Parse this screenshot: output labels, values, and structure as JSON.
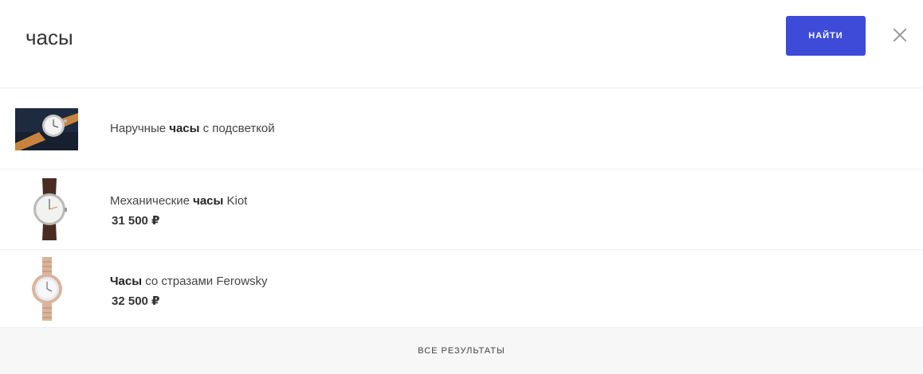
{
  "search": {
    "query": "часы",
    "button_label": "НАЙТИ",
    "accent_color": "#3e4bd8"
  },
  "results": [
    {
      "title_pre": "Наручные ",
      "title_bold": "часы",
      "title_post": " с подсветкой",
      "price": "",
      "thumb": "watch-leather-strap-photo"
    },
    {
      "title_pre": "Механические ",
      "title_bold": "часы",
      "title_post": " Kiot",
      "price": "31 500 ₽",
      "thumb": "watch-brown-strap-photo"
    },
    {
      "title_pre": "",
      "title_bold": "Часы",
      "title_post": " со стразами Ferowsky",
      "price": "32 500 ₽",
      "thumb": "watch-rose-gold-bracelet-photo"
    }
  ],
  "footer": {
    "all_results_label": "ВСЕ РЕЗУЛЬТАТЫ"
  }
}
